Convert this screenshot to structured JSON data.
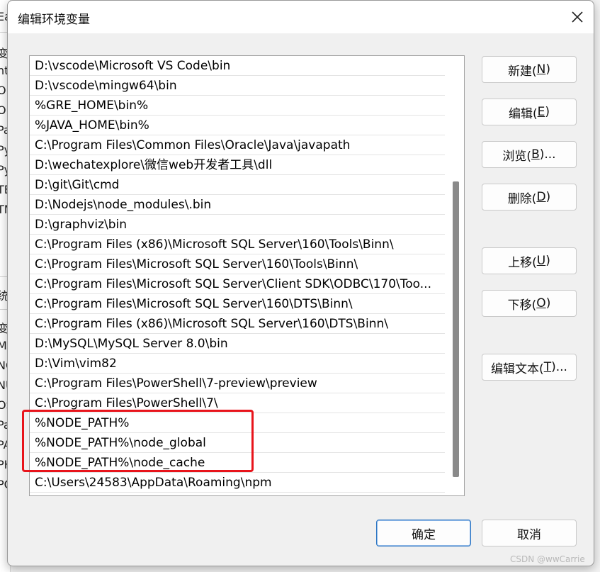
{
  "dialog": {
    "title": "编辑环境变量"
  },
  "path_entries": [
    "D:\\vscode\\Microsoft VS Code\\bin",
    "D:\\vscode\\mingw64\\bin",
    "%GRE_HOME\\bin%",
    "%JAVA_HOME\\bin%",
    "C:\\Program Files\\Common Files\\Oracle\\Java\\javapath",
    "D:\\wechatexplore\\微信web开发者工具\\dll",
    "D:\\git\\Git\\cmd",
    "D:\\Nodejs\\node_modules\\.bin",
    "D:\\graphviz\\bin",
    "C:\\Program Files (x86)\\Microsoft SQL Server\\160\\Tools\\Binn\\",
    "C:\\Program Files\\Microsoft SQL Server\\160\\Tools\\Binn\\",
    "C:\\Program Files\\Microsoft SQL Server\\Client SDK\\ODBC\\170\\Too...",
    "C:\\Program Files\\Microsoft SQL Server\\160\\DTS\\Binn\\",
    "C:\\Program Files (x86)\\Microsoft SQL Server\\160\\DTS\\Binn\\",
    "D:\\MySQL\\MySQL Server 8.0\\bin",
    "D:\\Vim\\vim82",
    "C:\\Program Files\\PowerShell\\7-preview\\preview",
    "C:\\Program Files\\PowerShell\\7\\",
    "%NODE_PATH%",
    "%NODE_PATH%\\node_global",
    "%NODE_PATH%\\node_cache",
    "C:\\Users\\24583\\AppData\\Roaming\\npm"
  ],
  "buttons": {
    "new": {
      "text": "新建(",
      "key": "N",
      "end": ")"
    },
    "edit": {
      "text": "编辑(",
      "key": "E",
      "end": ")"
    },
    "browse": {
      "text": "浏览(",
      "key": "B",
      "end": ")..."
    },
    "delete": {
      "text": "删除(",
      "key": "D",
      "end": ")"
    },
    "move_up": {
      "text": "上移(",
      "key": "U",
      "end": ")"
    },
    "move_down": {
      "text": "下移(",
      "key": "O",
      "end": ")"
    },
    "edit_text": {
      "text": "编辑文本(",
      "key": "T",
      "end": ")..."
    },
    "ok": "确定",
    "cancel": "取消"
  },
  "background_window": {
    "fragments": [
      "Ea",
      "变量",
      "nt",
      "On",
      "On",
      "Pa",
      "Py",
      "Py",
      "TE",
      "TM",
      "统变",
      "变量",
      "MA",
      "NC",
      "NU",
      "OS",
      "Pa",
      "PA",
      "PH",
      "PO"
    ]
  },
  "watermark": "CSDN @wwCarrie",
  "colors": {
    "highlight_border": "#e8141b",
    "primary_button_border": "#2f77c4"
  }
}
